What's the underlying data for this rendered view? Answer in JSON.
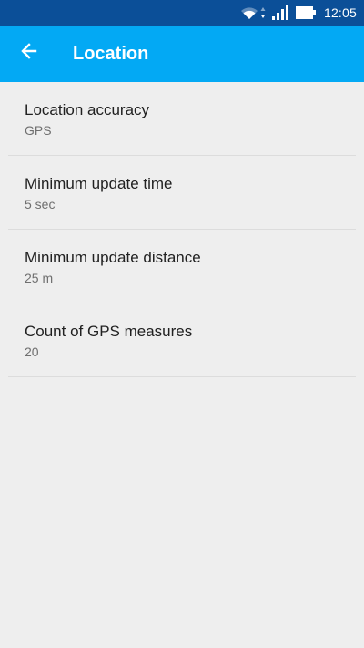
{
  "status_bar": {
    "time": "12:05",
    "icons": [
      "wifi-icon",
      "data-arrows-icon",
      "signal-icon",
      "battery-icon"
    ]
  },
  "app_bar": {
    "title": "Location",
    "back_icon": "arrow-left-icon",
    "color": "#03a9f4"
  },
  "preferences": [
    {
      "title": "Location accuracy",
      "summary": "GPS"
    },
    {
      "title": "Minimum update time",
      "summary": "5 sec"
    },
    {
      "title": "Minimum update distance",
      "summary": "25 m"
    },
    {
      "title": "Count of GPS measures",
      "summary": "20"
    }
  ],
  "colors": {
    "status_bar": "#0b4f98",
    "app_bar": "#03a9f4",
    "background": "#eeeeee",
    "title_text": "#212121",
    "summary_text": "#6f6f6f"
  }
}
